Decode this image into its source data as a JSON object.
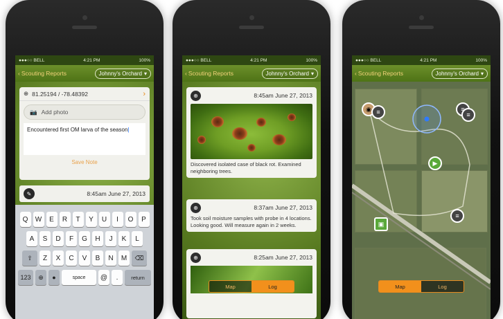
{
  "status": {
    "carrier": "●●●○○ BELL",
    "wifi": "≋",
    "time": "4:21 PM",
    "battery": "100%"
  },
  "nav": {
    "back_label": "Scouting Reports",
    "orchard": "Johnny's Orchard",
    "chevron": "⌄"
  },
  "note_screen": {
    "coords": "81.25194 / -78.48392",
    "add_photo": "Add photo",
    "note": "Encountered first OM larva of the season",
    "save": "Save Note",
    "entry_date": "8:45am  June 27, 2013"
  },
  "keyboard": {
    "row1": [
      "Q",
      "W",
      "E",
      "R",
      "T",
      "Y",
      "U",
      "I",
      "O",
      "P"
    ],
    "row2": [
      "A",
      "S",
      "D",
      "F",
      "G",
      "H",
      "J",
      "K",
      "L"
    ],
    "row3": [
      "Z",
      "X",
      "C",
      "V",
      "B",
      "N",
      "M"
    ],
    "shift": "⇧",
    "delete": "⌫",
    "num": "123",
    "globe": "⊕",
    "mic": "🎙",
    "space": "space",
    "at": "@",
    "dot": ".",
    "return": "return"
  },
  "log_screen": {
    "entries": [
      {
        "date": "8:45am  June 27, 2013",
        "text": "Discovered isolated case of black rot. Examined neighboring trees."
      },
      {
        "date": "8:37am  June 27, 2013",
        "text": "Took soil moisture samples with probe in 4 locations. Looking good. Will measure again in 2 weeks."
      },
      {
        "date": "8:25am  June 27, 2013",
        "text": ""
      }
    ],
    "seg_map": "Map",
    "seg_log": "Log"
  },
  "map_screen": {
    "seg_map": "Map",
    "seg_log": "Log"
  },
  "colors": {
    "accent": "#f2901c",
    "nav_green": "#5e8220",
    "back_text": "#f2d27a"
  }
}
